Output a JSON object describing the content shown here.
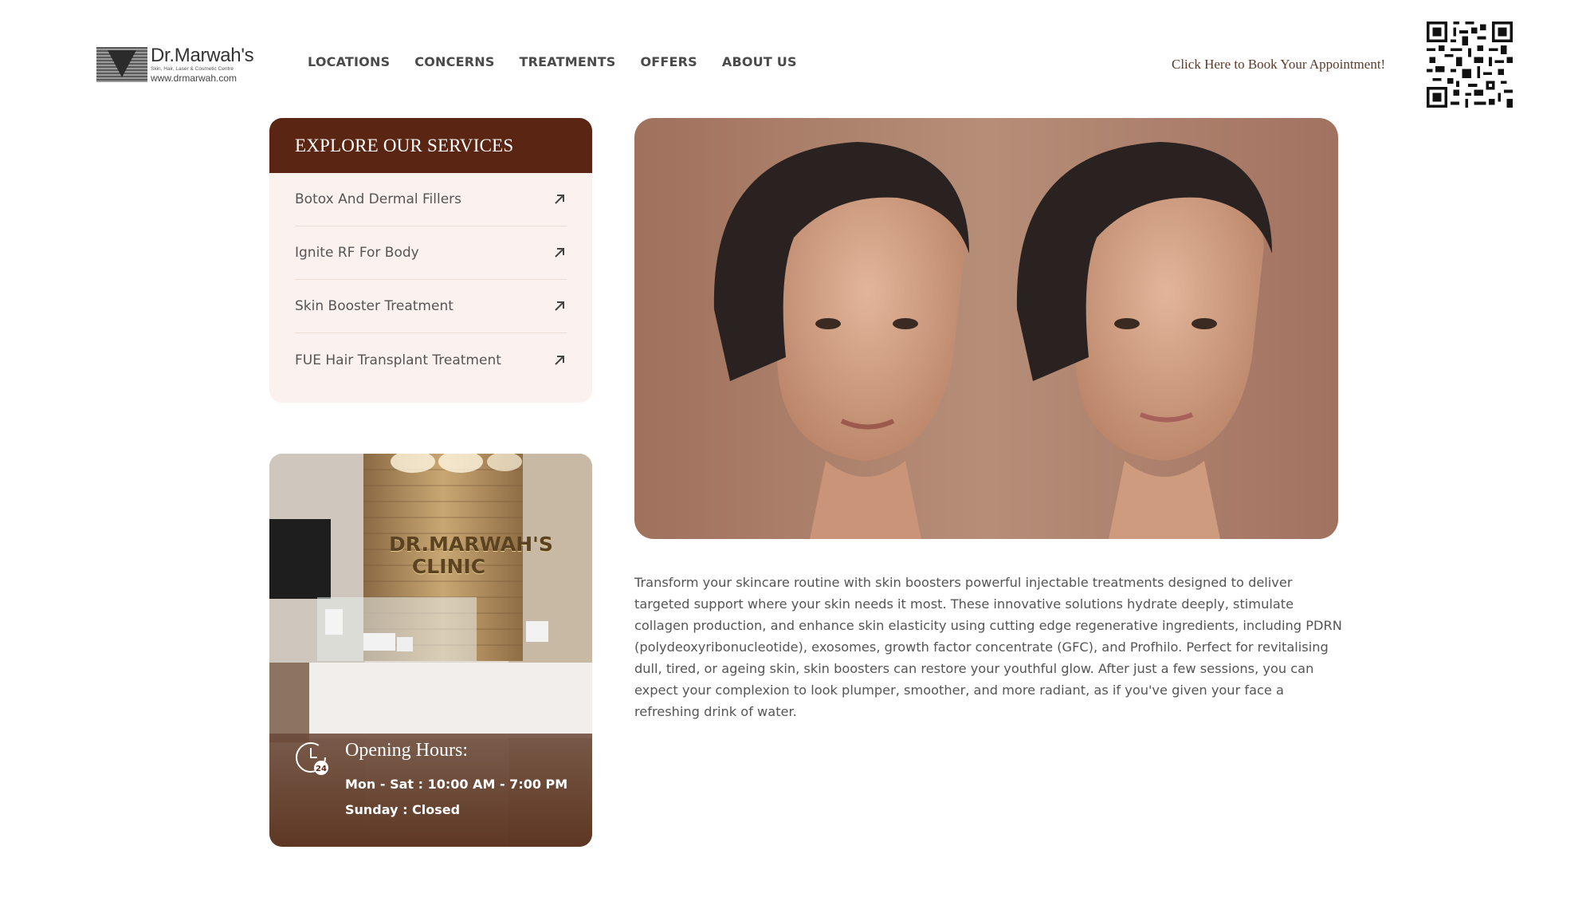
{
  "header": {
    "logo": {
      "name": "Dr.Marwah's",
      "tagline": "Skin, Hair, Laser & Cosmetic Centre",
      "url": "www.drmarwah.com"
    },
    "nav": [
      {
        "label": "LOCATIONS"
      },
      {
        "label": "CONCERNS"
      },
      {
        "label": "TREATMENTS"
      },
      {
        "label": "OFFERS"
      },
      {
        "label": "ABOUT US"
      }
    ],
    "book_link": "Click Here to Book Your Appointment!",
    "qr_icon": "qr-code-icon"
  },
  "services": {
    "title": "EXPLORE OUR SERVICES",
    "items": [
      {
        "label": "Botox And Dermal Fillers",
        "icon": "arrow-up-right-icon"
      },
      {
        "label": "Ignite RF For Body",
        "icon": "arrow-up-right-icon"
      },
      {
        "label": "Skin Booster Treatment",
        "icon": "arrow-up-right-icon"
      },
      {
        "label": "FUE Hair Transplant Treatment",
        "icon": "arrow-up-right-icon"
      }
    ]
  },
  "clinic": {
    "sign_line1": "DR.MARWAH'S",
    "sign_line2": "CLINIC",
    "hours_title": "Opening Hours:",
    "hours_weekday": "Mon - Sat : 10:00 AM - 7:00 PM",
    "hours_sunday": "Sunday : Closed",
    "clock_badge": "24"
  },
  "main": {
    "description": "Transform your skincare routine with skin boosters powerful injectable treatments designed to deliver targeted support where your skin needs it most. These innovative solutions hydrate deeply, stimulate collagen production, and enhance skin elasticity using cutting edge regenerative ingredients, including PDRN (polydeoxyribonucleotide), exosomes, growth factor concentrate (GFC), and Profhilo. Perfect for revitalising dull, tired, or ageing skin, skin boosters can restore your youthful glow. After just a few sessions, you can expect your complexion to look plumper, smoother, and more radiant, as if you've given your face a refreshing drink of water."
  },
  "colors": {
    "brand_brown": "#5a2613",
    "card_bg": "#fbf1ee",
    "hero_bg": "#ac7f69"
  }
}
